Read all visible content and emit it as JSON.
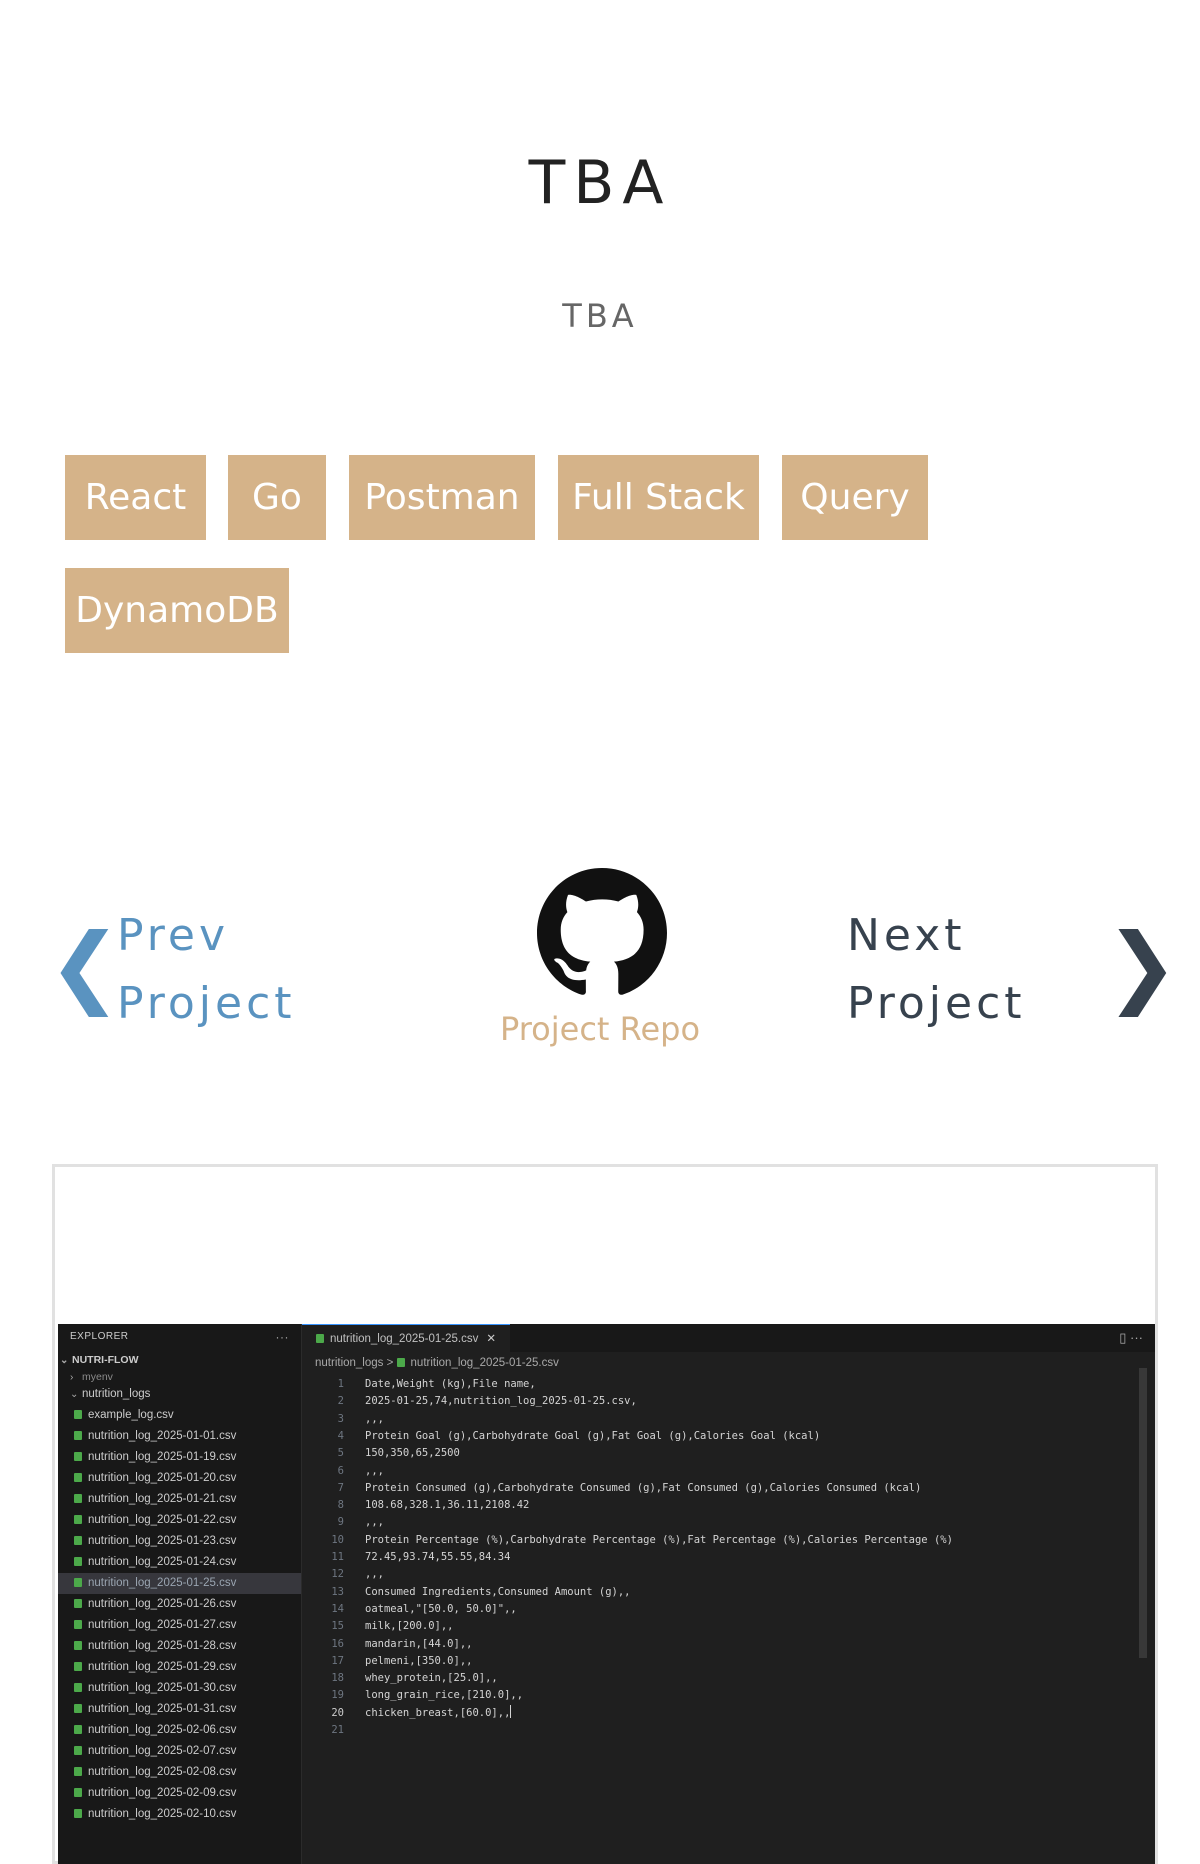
{
  "title": "TBA",
  "subtitle": "TBA",
  "tags": [
    "React",
    "Go",
    "Postman",
    "Full Stack",
    "Query",
    "DynamoDB"
  ],
  "nav": {
    "prev_line1": "Prev",
    "prev_line2": "Project",
    "prev_arrow": "❮",
    "next_line1": "Next",
    "next_line2": "Project",
    "next_arrow": "❯",
    "repo_label": "Project Repo",
    "repo_icon": "github-icon",
    "prev_color": "#5a93c0",
    "next_color": "#37424e",
    "accent": "#d5b389"
  },
  "screenshot": {
    "explorer_title": "EXPLORER",
    "explorer_menu": "···",
    "project": "NUTRI-FLOW",
    "folder_myenv": "myenv",
    "folder_logs": "nutrition_logs",
    "files": [
      "example_log.csv",
      "nutrition_log_2025-01-01.csv",
      "nutrition_log_2025-01-19.csv",
      "nutrition_log_2025-01-20.csv",
      "nutrition_log_2025-01-21.csv",
      "nutrition_log_2025-01-22.csv",
      "nutrition_log_2025-01-23.csv",
      "nutrition_log_2025-01-24.csv",
      "nutrition_log_2025-01-25.csv",
      "nutrition_log_2025-01-26.csv",
      "nutrition_log_2025-01-27.csv",
      "nutrition_log_2025-01-28.csv",
      "nutrition_log_2025-01-29.csv",
      "nutrition_log_2025-01-30.csv",
      "nutrition_log_2025-01-31.csv",
      "nutrition_log_2025-02-06.csv",
      "nutrition_log_2025-02-07.csv",
      "nutrition_log_2025-02-08.csv",
      "nutrition_log_2025-02-09.csv",
      "nutrition_log_2025-02-10.csv"
    ],
    "selected_file_index": 8,
    "tab_label": "nutrition_log_2025-01-25.csv",
    "tab_close": "✕",
    "breadcrumb_folder": "nutrition_logs",
    "breadcrumb_sep": ">",
    "breadcrumb_file": "nutrition_log_2025-01-25.csv",
    "current_line": 20,
    "code_lines": [
      "Date,Weight (kg),File name,",
      "2025-01-25,74,nutrition_log_2025-01-25.csv,",
      ",,,",
      "Protein Goal (g),Carbohydrate Goal (g),Fat Goal (g),Calories Goal (kcal)",
      "150,350,65,2500",
      ",,,",
      "Protein Consumed (g),Carbohydrate Consumed (g),Fat Consumed (g),Calories Consumed (kcal)",
      "108.68,328.1,36.11,2108.42",
      ",,,",
      "Protein Percentage (%),Carbohydrate Percentage (%),Fat Percentage (%),Calories Percentage (%)",
      "72.45,93.74,55.55,84.34",
      ",,,",
      "Consumed Ingredients,Consumed Amount (g),,",
      "oatmeal,\"[50.0, 50.0]\",,",
      "milk,[200.0],,",
      "mandarin,[44.0],,",
      "pelmeni,[350.0],,",
      "whey_protein,[25.0],,",
      "long_grain_rice,[210.0],,",
      "chicken_breast,[60.0],,",
      ""
    ]
  }
}
